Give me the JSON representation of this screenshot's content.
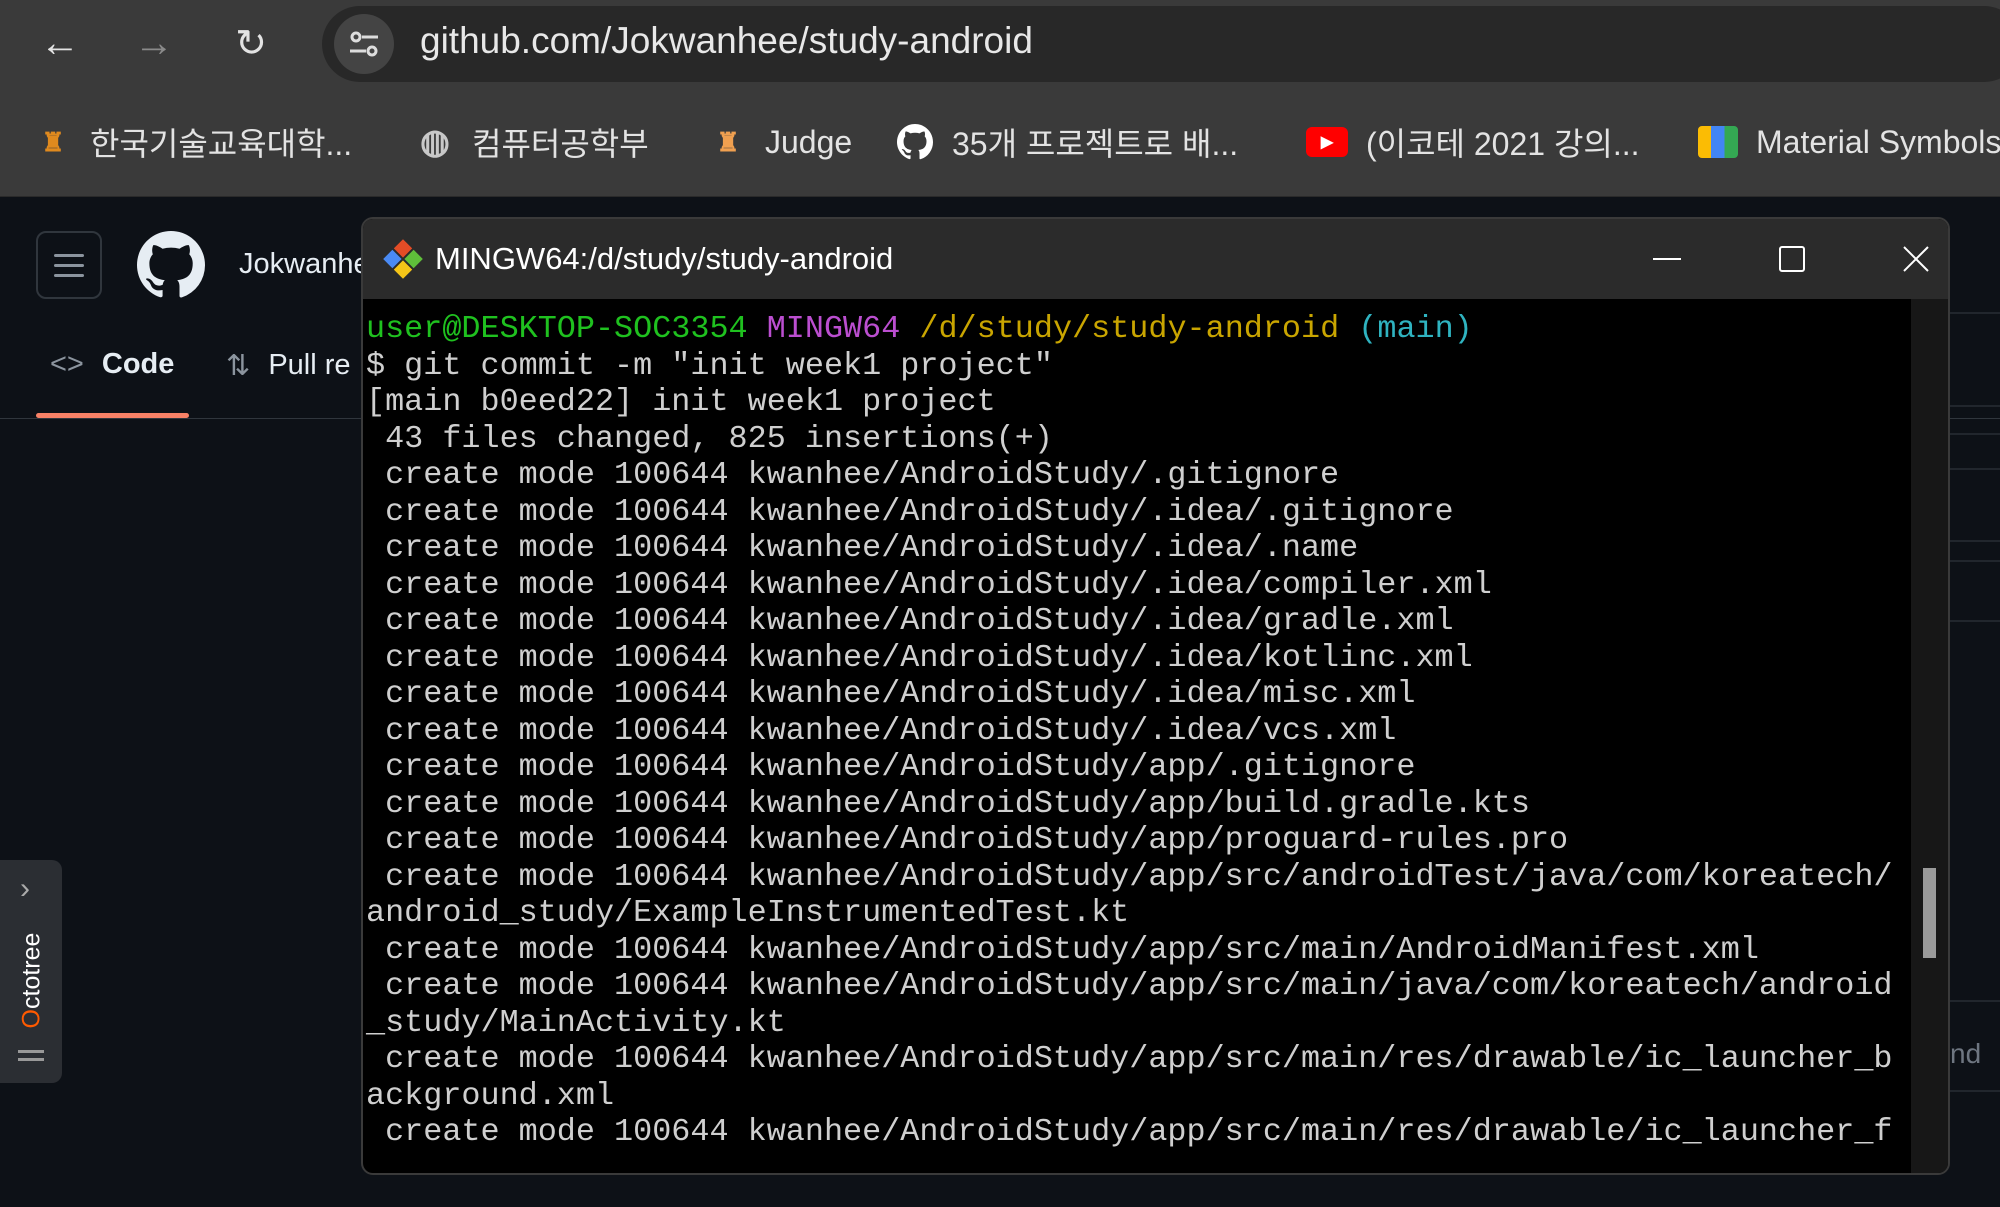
{
  "browser": {
    "url": "github.com/Jokwanhee/study-android",
    "nav": {
      "back_icon": "arrow-left-icon",
      "forward_icon": "arrow-right-icon",
      "reload_icon": "reload-icon",
      "site_info_icon": "tune-icon"
    },
    "bookmarks": [
      {
        "label": "한국기술교육대학...",
        "icon": "koreatech-logo-icon",
        "color": "#e08a1e"
      },
      {
        "label": "컴퓨터공학부",
        "icon": "globe-icon",
        "color": "#c8c8c8"
      },
      {
        "label": "Judge",
        "icon": "judge-logo-icon",
        "color": "#f0a050"
      },
      {
        "label": "35개 프로젝트로 배...",
        "icon": "github-icon",
        "color": "#ffffff"
      },
      {
        "label": "(이코테 2021 강의...",
        "icon": "youtube-icon",
        "color": "#ff0000"
      },
      {
        "label": "Material Symbols",
        "icon": "google-fonts-icon",
        "color": "#4285f4"
      }
    ]
  },
  "github": {
    "owner": "Jokwanhe",
    "tabs": [
      {
        "label": "Code",
        "active": true
      },
      {
        "label": "Pull re"
      }
    ],
    "partial_text": "nd",
    "accent": "#f78166"
  },
  "octotree": {
    "label": "Octotree"
  },
  "terminal": {
    "title": "MINGW64:/d/study/study-android",
    "prompt": {
      "user_host": "user@DESKTOP-SOC3354",
      "shell": "MINGW64",
      "path": "/d/study/study-android",
      "branch": "(main)"
    },
    "colors": {
      "user_host": "#1fc11f",
      "shell": "#bb4ed0",
      "path": "#c9a500",
      "branch": "#2fb3c0",
      "text": "#cfcfcf"
    },
    "lines": [
      "$ git commit -m \"init week1 project\"",
      "[main b0eed22] init week1 project",
      " 43 files changed, 825 insertions(+)",
      " create mode 100644 kwanhee/AndroidStudy/.gitignore",
      " create mode 100644 kwanhee/AndroidStudy/.idea/.gitignore",
      " create mode 100644 kwanhee/AndroidStudy/.idea/.name",
      " create mode 100644 kwanhee/AndroidStudy/.idea/compiler.xml",
      " create mode 100644 kwanhee/AndroidStudy/.idea/gradle.xml",
      " create mode 100644 kwanhee/AndroidStudy/.idea/kotlinc.xml",
      " create mode 100644 kwanhee/AndroidStudy/.idea/misc.xml",
      " create mode 100644 kwanhee/AndroidStudy/.idea/vcs.xml",
      " create mode 100644 kwanhee/AndroidStudy/app/.gitignore",
      " create mode 100644 kwanhee/AndroidStudy/app/build.gradle.kts",
      " create mode 100644 kwanhee/AndroidStudy/app/proguard-rules.pro",
      " create mode 100644 kwanhee/AndroidStudy/app/src/androidTest/java/com/koreatech/",
      "android_study/ExampleInstrumentedTest.kt",
      " create mode 100644 kwanhee/AndroidStudy/app/src/main/AndroidManifest.xml",
      " create mode 100644 kwanhee/AndroidStudy/app/src/main/java/com/koreatech/android",
      "_study/MainActivity.kt",
      " create mode 100644 kwanhee/AndroidStudy/app/src/main/res/drawable/ic_launcher_b",
      "ackground.xml",
      " create mode 100644 kwanhee/AndroidStudy/app/src/main/res/drawable/ic_launcher_f"
    ],
    "scroll_position": 0.72
  }
}
